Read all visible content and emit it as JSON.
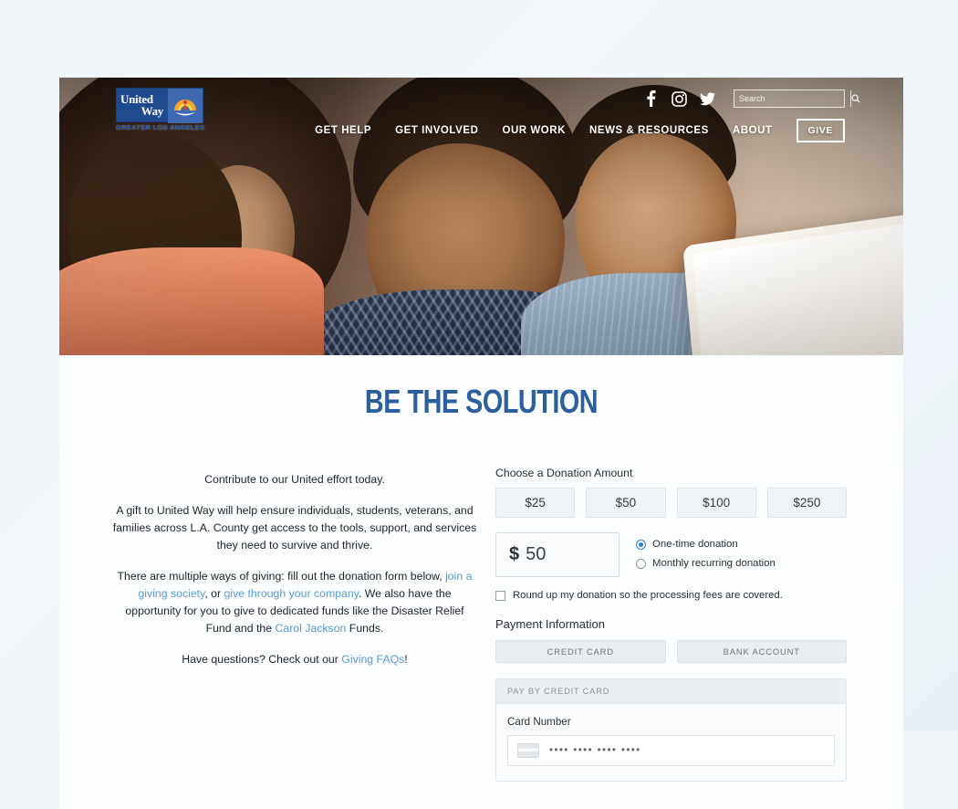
{
  "brand": {
    "logo_line1": "United",
    "logo_line2": "Way",
    "logo_tagline": "GREATER LOS ANGELES",
    "accent_blue": "#2c5f9e",
    "link_blue": "#5b9bd8",
    "logo_box_blue": "#1f4a8f"
  },
  "header": {
    "social": [
      {
        "name": "facebook-icon",
        "glyph": "f"
      },
      {
        "name": "instagram-icon",
        "glyph": "▢"
      },
      {
        "name": "twitter-icon",
        "glyph": "ᴠ"
      }
    ],
    "search": {
      "placeholder": "Search",
      "value": "",
      "button_icon": "search-icon"
    },
    "nav": [
      {
        "label": "GET HELP"
      },
      {
        "label": "GET INVOLVED"
      },
      {
        "label": "OUR WORK"
      },
      {
        "label": "NEWS & RESOURCES"
      },
      {
        "label": "ABOUT"
      }
    ],
    "give_label": "GIVE"
  },
  "main": {
    "title": "BE THE SOLUTION",
    "intro": "Contribute to our United effort today.",
    "paragraph2": "A gift to United Way will help ensure individuals, students, veterans, and families across L.A. County get access to the tools, support, and services they need to survive and thrive.",
    "paragraph3": {
      "part1": "There are multiple ways of giving: fill out the donation form below, ",
      "link1": "join a giving society",
      "part2": ", or ",
      "link2": "give through your company",
      "part3": ". We also have the opportunity for you to give to dedicated funds like the Disaster Relief Fund and the ",
      "link3": "Carol Jackson",
      "part4": " Funds."
    },
    "paragraph4": {
      "part1": "Have questions? Check out our ",
      "link1": "Giving FAQs",
      "part2": "!"
    }
  },
  "donation": {
    "amount_label": "Choose a Donation Amount",
    "amounts": [
      {
        "label": "$25",
        "value": 25
      },
      {
        "label": "$50",
        "value": 50
      },
      {
        "label": "$100",
        "value": 100
      },
      {
        "label": "$250",
        "value": 250
      }
    ],
    "custom": {
      "currency": "$",
      "value": "50"
    },
    "frequency": [
      {
        "label": "One-time donation",
        "selected": true
      },
      {
        "label": "Monthly recurring donation",
        "selected": false
      }
    ],
    "roundup": {
      "label": "Round up my donation so the processing fees are covered.",
      "checked": false
    }
  },
  "payment": {
    "section_label": "Payment Information",
    "tabs": [
      {
        "label": "CREDIT CARD",
        "active": true
      },
      {
        "label": "BANK ACCOUNT",
        "active": false
      }
    ],
    "panel_title": "PAY BY CREDIT CARD",
    "card_number_label": "Card Number",
    "card_number_placeholder": "•••• •••• •••• ••••"
  }
}
